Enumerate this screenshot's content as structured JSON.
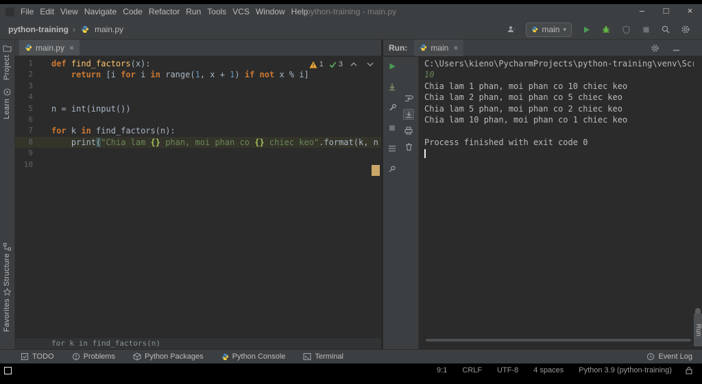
{
  "titlebar": {
    "menus": [
      "File",
      "Edit",
      "View",
      "Navigate",
      "Code",
      "Refactor",
      "Run",
      "Tools",
      "VCS",
      "Window",
      "Help"
    ],
    "title": "python-training - main.py",
    "controls": {
      "minimize": "–",
      "maximize": "□",
      "close": "×"
    }
  },
  "toolbar": {
    "breadcrumb_project": "python-training",
    "breadcrumb_separator": "›",
    "breadcrumb_file": "main.py",
    "run_config": "main",
    "caret": "▾"
  },
  "left_stripe": {
    "project": "Project",
    "learn": "Learn",
    "structure": "Structure",
    "favorites": "Favorites"
  },
  "editor": {
    "tab": "main.py",
    "close": "×",
    "inspections": {
      "warnings": "1",
      "typos": "3"
    },
    "context_line": "for k in find_factors(n)",
    "lines": [
      {
        "n": "1",
        "tokens": [
          {
            "t": "def ",
            "c": "k"
          },
          {
            "t": "find_factors",
            "c": "f"
          },
          {
            "t": "(x):",
            "c": "d"
          }
        ]
      },
      {
        "n": "2",
        "tokens": [
          {
            "t": "    ",
            "c": "d"
          },
          {
            "t": "return ",
            "c": "k"
          },
          {
            "t": "[i ",
            "c": "d"
          },
          {
            "t": "for ",
            "c": "k"
          },
          {
            "t": "i ",
            "c": "d"
          },
          {
            "t": "in ",
            "c": "k"
          },
          {
            "t": "range(",
            "c": "d"
          },
          {
            "t": "1",
            "c": "n"
          },
          {
            "t": ", x + ",
            "c": "d"
          },
          {
            "t": "1",
            "c": "n"
          },
          {
            "t": ") ",
            "c": "d"
          },
          {
            "t": "if not ",
            "c": "k"
          },
          {
            "t": "x % i]",
            "c": "d"
          }
        ]
      },
      {
        "n": "3",
        "tokens": []
      },
      {
        "n": "4",
        "tokens": []
      },
      {
        "n": "5",
        "tokens": [
          {
            "t": "n = int(input())",
            "c": "d"
          }
        ]
      },
      {
        "n": "6",
        "tokens": []
      },
      {
        "n": "7",
        "tokens": [
          {
            "t": "for ",
            "c": "k"
          },
          {
            "t": "k ",
            "c": "d"
          },
          {
            "t": "in ",
            "c": "k"
          },
          {
            "t": "find_factors(n):",
            "c": "d"
          }
        ]
      },
      {
        "n": "8",
        "current": true,
        "tokens": [
          {
            "t": "    print",
            "c": "d"
          },
          {
            "t": "(",
            "c": "m"
          },
          {
            "t": "\"Chia lam ",
            "c": "s"
          },
          {
            "t": "{}",
            "c": "p"
          },
          {
            "t": " phan, moi phan co ",
            "c": "s"
          },
          {
            "t": "{}",
            "c": "p"
          },
          {
            "t": " chiec keo\"",
            "c": "s"
          },
          {
            "t": ".format(k, n // k)",
            "c": "d"
          },
          {
            "t": ")",
            "c": "m"
          }
        ]
      },
      {
        "n": "9",
        "tokens": []
      },
      {
        "n": "10",
        "tokens": []
      }
    ]
  },
  "run_panel": {
    "label": "Run:",
    "tab": "main",
    "close": "×",
    "console_lines": [
      {
        "text": "C:\\Users\\kieno\\PycharmProjects\\python-training\\venv\\Scripts\\pyth",
        "cls": "out"
      },
      {
        "text": "10",
        "cls": "stdin"
      },
      {
        "text": "Chia lam 1 phan, moi phan co 10 chiec keo",
        "cls": "out"
      },
      {
        "text": "Chia lam 2 phan, moi phan co 5 chiec keo",
        "cls": "out"
      },
      {
        "text": "Chia lam 5 phan, moi phan co 2 chiec keo",
        "cls": "out"
      },
      {
        "text": "Chia lam 10 phan, moi phan co 1 chiec keo",
        "cls": "out"
      },
      {
        "text": "",
        "cls": "out"
      },
      {
        "text": "Process finished with exit code 0",
        "cls": "out"
      }
    ],
    "stripe_button": "Run"
  },
  "bottom_bar": {
    "items": [
      "TODO",
      "Problems",
      "Python Packages",
      "Python Console",
      "Terminal"
    ],
    "right": "Event Log"
  },
  "status_bar": {
    "items": [
      "9:1",
      "CRLF",
      "UTF-8",
      "4 spaces",
      "Python 3.9 (python-training)"
    ]
  },
  "colors": {
    "accent_green": "#499c54",
    "warning_yellow": "#f0a732",
    "panel": "#3c3f41",
    "editor_bg": "#2b2b2b"
  }
}
